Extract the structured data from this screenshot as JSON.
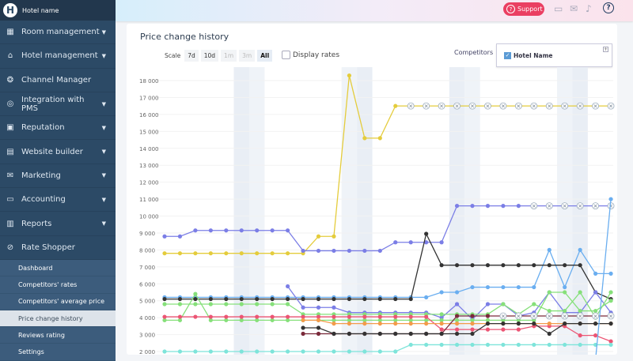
{
  "brand": {
    "name": "Hotel name",
    "logo_letter": "H"
  },
  "sidebar": {
    "items": [
      {
        "label": "Room management",
        "icon": "calendar-icon",
        "glyph": "▦",
        "chevron": true
      },
      {
        "label": "Hotel management",
        "icon": "house-icon",
        "glyph": "⌂",
        "chevron": true
      },
      {
        "label": "Channel Manager",
        "icon": "network-icon",
        "glyph": "❂",
        "chevron": false
      },
      {
        "label": "Integration with PMS",
        "icon": "integration-icon",
        "glyph": "◎",
        "chevron": true
      },
      {
        "label": "Reputation",
        "icon": "chat-icon",
        "glyph": "▣",
        "chevron": true
      },
      {
        "label": "Website builder",
        "icon": "website-icon",
        "glyph": "▤",
        "chevron": true
      },
      {
        "label": "Marketing",
        "icon": "mail-icon",
        "glyph": "✉",
        "chevron": true
      },
      {
        "label": "Accounting",
        "icon": "folder-icon",
        "glyph": "▭",
        "chevron": true
      },
      {
        "label": "Reports",
        "icon": "bar-chart-icon",
        "glyph": "▥",
        "chevron": true
      },
      {
        "label": "Rate Shopper",
        "icon": "rate-shopper-icon",
        "glyph": "⊘",
        "chevron": false
      }
    ],
    "subitems": [
      {
        "label": "Dashboard"
      },
      {
        "label": "Competitors' rates"
      },
      {
        "label": "Competitors' average price"
      },
      {
        "label": "Price change history",
        "active": true
      },
      {
        "label": "Reviews rating"
      },
      {
        "label": "Settings"
      }
    ]
  },
  "topbar": {
    "support_label": "Support"
  },
  "page": {
    "title": "Price change history",
    "scale_label": "Scale",
    "scale_options": [
      "7d",
      "10d",
      "1m",
      "3m",
      "All"
    ],
    "scale_selected": "All",
    "display_rates_label": "Display rates",
    "display_rates_checked": false,
    "competitors_label": "Competitors",
    "competitor": "Hotel Name",
    "competitor_checked": true
  },
  "chart_data": {
    "type": "line",
    "ylim": [
      2000,
      18000
    ],
    "yticks": [
      "18 000",
      "17 000",
      "16 000",
      "15 000",
      "14 000",
      "13 000",
      "12 000",
      "11 000",
      "10 000",
      "9 000",
      "8 000",
      "7 000",
      "6 000",
      "5 000",
      "4 000",
      "3 000",
      "2 000"
    ],
    "weekend_indices": [
      5,
      6,
      12,
      13,
      19,
      20,
      26,
      27
    ],
    "series": [
      {
        "color": "#e4cc3c",
        "values": [
          7800,
          7800,
          7800,
          7800,
          7800,
          7800,
          7800,
          7800,
          7800,
          7800,
          8800,
          8800,
          18300,
          14600,
          14600,
          16500,
          16500,
          16500,
          16500,
          16500,
          16500,
          16500,
          16500,
          16500,
          16500,
          16500,
          16500,
          16500,
          16500,
          16500
        ],
        "marked_from": 16
      },
      {
        "color": "#7b7ee6",
        "values": [
          8800,
          8800,
          9150,
          9150,
          9150,
          9150,
          9150,
          9150,
          9150,
          7950,
          7950,
          7950,
          7950,
          7950,
          7950,
          8450,
          8450,
          8450,
          8450,
          10600,
          10600,
          10600,
          10600,
          10600,
          10600,
          10600,
          10600,
          10600,
          10600,
          10600
        ],
        "marked_from": 24
      },
      {
        "color": "#6aaef0",
        "values": [
          5200,
          5200,
          5200,
          5200,
          5200,
          5200,
          5200,
          5200,
          5200,
          5200,
          5200,
          5200,
          5200,
          5200,
          5200,
          5200,
          5200,
          5200,
          5500,
          5500,
          5800,
          5800,
          5800,
          5800,
          5800,
          8000,
          5800,
          8000,
          6600,
          6600
        ]
      },
      {
        "color": "#333333",
        "values": [
          5100,
          5100,
          5100,
          5100,
          5100,
          5100,
          5100,
          5100,
          5100,
          5100,
          5100,
          5100,
          5100,
          5100,
          5100,
          5100,
          5100,
          8950,
          7100,
          7100,
          7100,
          7100,
          7100,
          7100,
          7100,
          7100,
          7100,
          7100,
          5500,
          5100
        ]
      },
      {
        "color": "#7b7ee6",
        "values": [
          null,
          null,
          null,
          null,
          null,
          null,
          null,
          null,
          5850,
          4600,
          4600,
          4600,
          4300,
          4300,
          4300,
          4300,
          4300,
          4300,
          4000,
          4800,
          3900,
          4800,
          4800,
          4100,
          4300,
          5500,
          4300,
          4300,
          5500,
          4300
        ]
      },
      {
        "color": "#86e07a",
        "values": [
          4800,
          4800,
          4800,
          4800,
          4800,
          4800,
          4800,
          4800,
          4800,
          4200,
          4200,
          4200,
          4200,
          4200,
          4200,
          4200,
          4200,
          4200,
          4200,
          4200,
          4200,
          4200,
          4800,
          4200,
          4800,
          4400,
          4400,
          5500,
          4000,
          5500
        ]
      },
      {
        "color": "#86e07a",
        "values": [
          3850,
          3850,
          5400,
          3850,
          3850,
          3850,
          3850,
          3850,
          3850,
          3850,
          3850,
          3850,
          3850,
          3850,
          3850,
          3850,
          3850,
          3850,
          3850,
          3850,
          3850,
          3850,
          3850,
          3850,
          3850,
          5500,
          5500,
          4400,
          4400,
          5000
        ]
      },
      {
        "color": "#ec5574",
        "values": [
          4050,
          4050,
          4050,
          4050,
          4050,
          4050,
          4050,
          4050,
          4050,
          4050,
          4050,
          4050,
          4050,
          4050,
          4050,
          4050,
          4050,
          4050,
          3300,
          3300,
          3300,
          3300,
          3300,
          3300,
          3500,
          3500,
          3500,
          2950,
          2950,
          2600
        ]
      },
      {
        "color": "#f39b4b",
        "values": [
          null,
          null,
          null,
          null,
          null,
          null,
          null,
          null,
          null,
          3850,
          3850,
          3650,
          3650,
          3650,
          3650,
          3650,
          3650,
          3650,
          3650,
          3650,
          3650,
          3650,
          3650,
          3650,
          3650,
          3650,
          3650,
          3650,
          3650,
          3650
        ]
      },
      {
        "color": "#7a2a3a",
        "values": [
          null,
          null,
          null,
          null,
          null,
          null,
          null,
          null,
          null,
          3050,
          3050,
          3050,
          3050,
          3050,
          3050,
          3050,
          3050,
          3050,
          3050,
          4100,
          4100,
          4100,
          4100,
          4100,
          4100,
          4100,
          4100,
          4100,
          4100,
          4100
        ],
        "marked_from": 22
      },
      {
        "color": "#333333",
        "values": [
          null,
          null,
          null,
          null,
          null,
          null,
          null,
          null,
          null,
          3400,
          3400,
          3050,
          3050,
          3050,
          3050,
          3050,
          3050,
          3050,
          3050,
          3050,
          3050,
          3650,
          3650,
          3650,
          3650,
          3050,
          3650,
          3650,
          3650,
          3650
        ]
      },
      {
        "color": "#7ee4da",
        "values": [
          2000,
          2000,
          2000,
          2000,
          2000,
          2000,
          2000,
          2000,
          2000,
          2000,
          2000,
          2000,
          2000,
          2000,
          2000,
          2000,
          2400,
          2400,
          2400,
          2400,
          2400,
          2400,
          2400,
          2400,
          2400,
          2400,
          2400,
          2400,
          2400,
          2400
        ]
      },
      {
        "color": "#6aaef0",
        "values": [
          null,
          null,
          null,
          null,
          null,
          null,
          null,
          null,
          null,
          null,
          null,
          null,
          null,
          null,
          null,
          null,
          null,
          null,
          null,
          null,
          null,
          null,
          null,
          null,
          null,
          null,
          null,
          null,
          1500,
          11000
        ]
      }
    ]
  }
}
